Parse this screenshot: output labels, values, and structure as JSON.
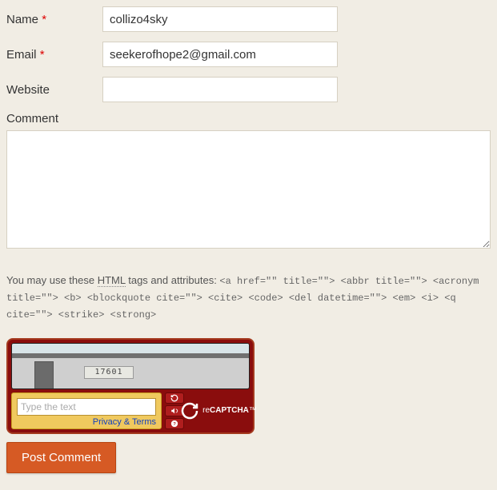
{
  "fields": {
    "name": {
      "label": "Name",
      "required": "*",
      "value": "collizo4sky"
    },
    "email": {
      "label": "Email",
      "required": "*",
      "value": "seekerofhope2@gmail.com"
    },
    "website": {
      "label": "Website",
      "required": "",
      "value": ""
    },
    "comment": {
      "label": "Comment",
      "value": ""
    }
  },
  "hint": {
    "prefix": "You may use these ",
    "abbr": "HTML",
    "mid": " tags and attributes: ",
    "code": "<a href=\"\" title=\"\"> <abbr title=\"\"> <acronym title=\"\"> <b> <blockquote cite=\"\"> <cite> <code> <del datetime=\"\"> <em> <i> <q cite=\"\"> <strike> <strong>"
  },
  "captcha": {
    "image_text": "17601",
    "placeholder": "Type the text",
    "privacy": "Privacy & Terms",
    "logo_pre": "re",
    "logo_post": "CAPTCHA",
    "tm": "™"
  },
  "submit": {
    "label": "Post Comment"
  }
}
